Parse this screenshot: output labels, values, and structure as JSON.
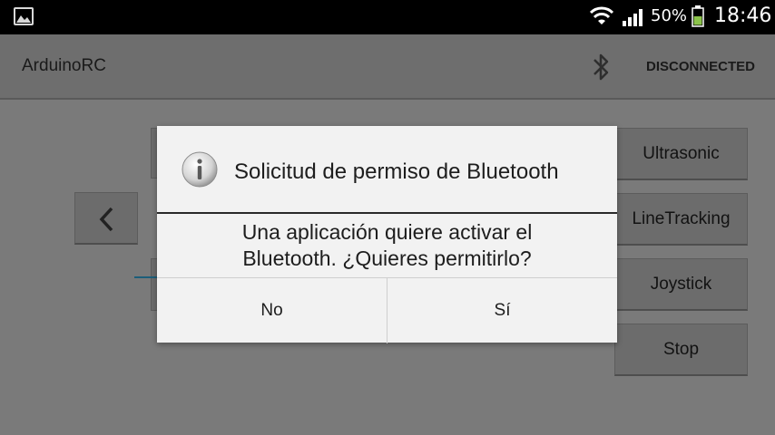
{
  "status_bar": {
    "battery_percent": "50%",
    "time": "18:46",
    "icons": [
      "gallery-icon",
      "wifi-icon",
      "signal-icon",
      "battery-icon"
    ]
  },
  "app_bar": {
    "title": "ArduinoRC",
    "bluetooth_icon": "bluetooth-icon",
    "connection_status": "DISCONNECTED"
  },
  "main": {
    "buttons": [
      {
        "label": "Ultrasonic"
      },
      {
        "label": "LineTracking"
      },
      {
        "label": "Joystick"
      },
      {
        "label": "Stop"
      }
    ],
    "left_arrow_icon": "chevron-left-icon"
  },
  "dialog": {
    "icon": "info-icon",
    "title": "Solicitud de permiso de Bluetooth",
    "message_line1": "Una aplicación quiere activar el",
    "message_line2": "Bluetooth. ¿Quieres permitirlo?",
    "no_label": "No",
    "yes_label": "Sí"
  },
  "colors": {
    "status_bar_bg": "#000000",
    "dim_overlay": "#7a7a7a",
    "dialog_bg": "#f2f2f2",
    "seek_line": "#1c5e7a",
    "battery_fill": "#8bc34a"
  }
}
